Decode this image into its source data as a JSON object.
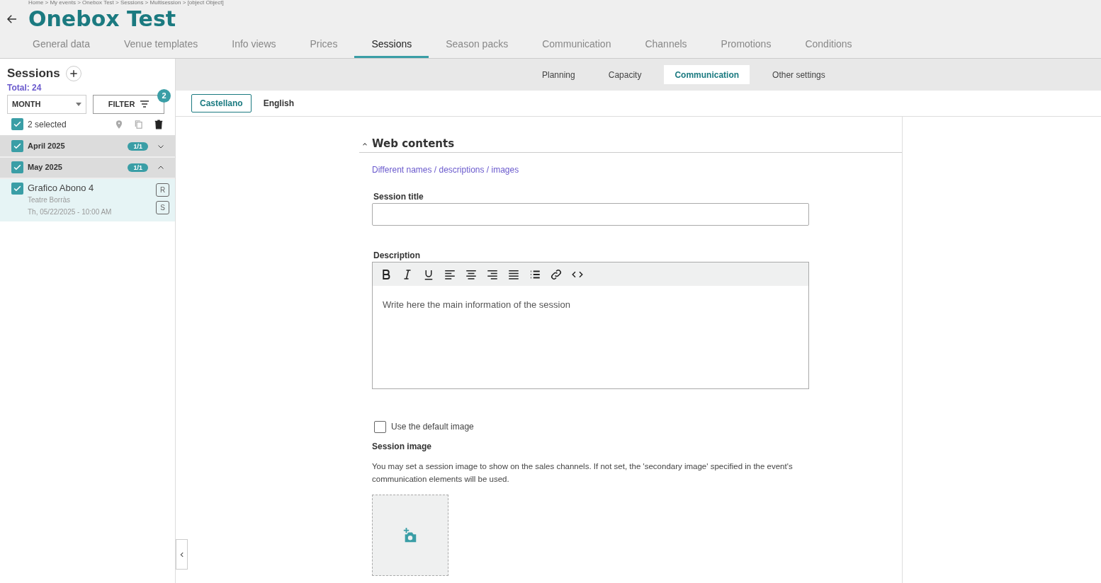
{
  "breadcrumb": "Home > My events > Onebox Test > Sessions > Multisession > [object Object]",
  "title": "Onebox Test",
  "tabs": [
    {
      "label": "General data",
      "selected": false
    },
    {
      "label": "Venue templates",
      "selected": false
    },
    {
      "label": "Info views",
      "selected": false
    },
    {
      "label": "Prices",
      "selected": false
    },
    {
      "label": "Sessions",
      "selected": true
    },
    {
      "label": "Season packs",
      "selected": false
    },
    {
      "label": "Communication",
      "selected": false
    },
    {
      "label": "Channels",
      "selected": false
    },
    {
      "label": "Promotions",
      "selected": false
    },
    {
      "label": "Conditions",
      "selected": false
    }
  ],
  "sidebar": {
    "title": "Sessions",
    "total": "Total: 24",
    "view_select": "MONTH",
    "filter_button": "FILTER",
    "filter_count": "2",
    "selection": {
      "label": "2 selected",
      "checked": true
    },
    "groups": [
      {
        "label": "April 2025",
        "checked": true,
        "count": "1/1",
        "expanded": false
      },
      {
        "label": "May 2025",
        "checked": true,
        "count": "1/1",
        "expanded": true,
        "sessions": [
          {
            "name": "Grafico Abono 4",
            "venue": "Teatre Borràs",
            "date": "Th, 05/22/2025 - 10:00 AM",
            "checked": true,
            "badges": [
              "R",
              "S"
            ]
          }
        ]
      }
    ]
  },
  "subtabs": [
    {
      "label": "Planning",
      "selected": false
    },
    {
      "label": "Capacity",
      "selected": false
    },
    {
      "label": "Communication",
      "selected": true
    },
    {
      "label": "Other settings",
      "selected": false
    }
  ],
  "languages": [
    {
      "label": "Castellano",
      "selected": true
    },
    {
      "label": "English",
      "selected": false
    }
  ],
  "section": {
    "title": "Web contents",
    "expanded": true,
    "link": "Different names / descriptions / images",
    "session_title_label": "Session title",
    "description_label": "Description",
    "description_placeholder": "Write here the main information of the session",
    "default_image": {
      "label": "Use the default image",
      "checked": false
    },
    "image_label": "Session image",
    "image_help": "You may set a session image to show on the sales channels. If not set, the 'secondary image' specified in the event's communication elements will be used."
  }
}
